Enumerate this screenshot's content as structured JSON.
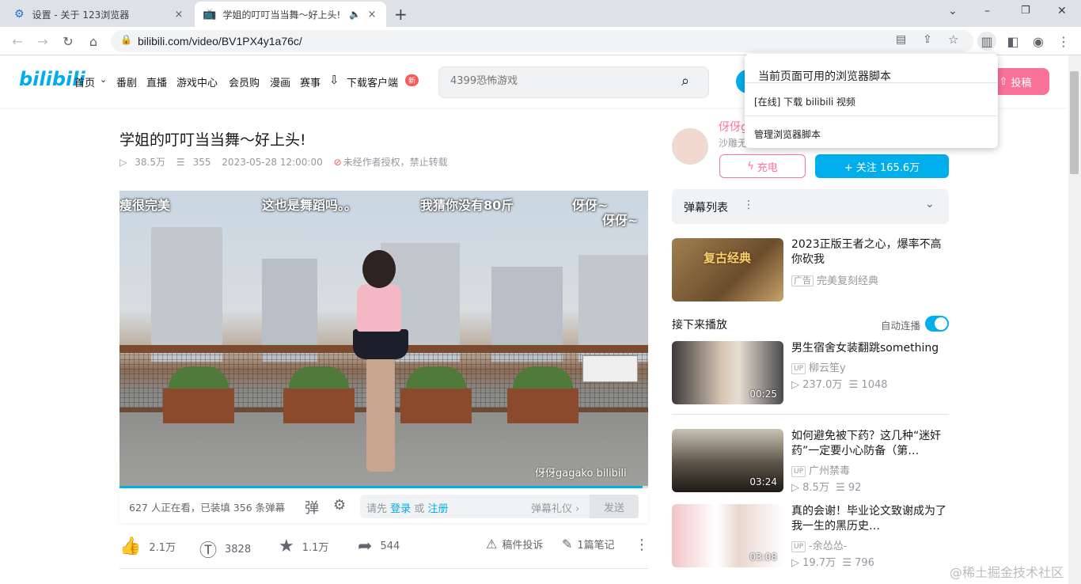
{
  "browser": {
    "tabs": [
      {
        "title": "设置 - 关于 123浏览器",
        "close": "×"
      },
      {
        "title": "学姐的叮叮当当舞～好上头!",
        "close": "×"
      }
    ],
    "new_tab": "+",
    "window_controls": {
      "dropdown": "⌄",
      "minimize": "–",
      "maximize": "❐",
      "close": "✕"
    },
    "url": "bilibili.com/video/BV1PX4y1a76c/"
  },
  "popup": {
    "heading": "当前页面可用的浏览器脚本",
    "items": [
      "[在线] 下载 bilibili 视频",
      "管理浏览器脚本"
    ]
  },
  "header": {
    "logo": "bilibili",
    "nav": [
      "首页",
      "番剧",
      "直播",
      "游戏中心",
      "会员购",
      "漫画",
      "赛事",
      "下载客户端"
    ],
    "new_badge": "新",
    "search_placeholder": "4399恐怖游戏",
    "upload_label": "投稿"
  },
  "video": {
    "title": "学姐的叮叮当当舞～好上头!",
    "views": "38.5万",
    "danmaku_count": "355",
    "date": "2023-05-28 12:00:00",
    "copyright": "未经作者授权，禁止转载",
    "subtitles": [
      "瘦很完美",
      "这也是舞蹈吗。。",
      "我猜你没有80斤",
      "伢伢~",
      "伢伢~"
    ],
    "watermark": "伢伢gagako bilibili",
    "progress": 0.99,
    "viewers_line": "627 人正在看，已装填 356 条弹幕",
    "danmaku_hint_prefix": "请先",
    "login": "登录",
    "or": "或",
    "register": "注册",
    "etiquette": "弹幕礼仪 ›",
    "send": "发送",
    "likes": "2.1万",
    "coins": "3828",
    "favorites": "1.1万",
    "shares": "544",
    "report": "稿件投诉",
    "notes": "1篇笔记"
  },
  "uploader": {
    "name": "伢伢gagako",
    "desc": "沙雕无",
    "charge": "充电",
    "follow": "+ 关注 165.6万"
  },
  "right": {
    "danmaku_list": "弹幕列表",
    "ad": {
      "title": "2023正版王者之心，爆率不高你砍我",
      "tag": "广告",
      "source": "完美复刻经典",
      "thumb_text": "复古经典"
    },
    "up_next": "接下来播放",
    "autoplay": "自动连播",
    "items": [
      {
        "title": "男生宿舍女装翻跳something",
        "up": "柳云笙y",
        "views": "237.0万",
        "danmaku": "1048",
        "duration": "00:25"
      },
      {
        "title": "如何避免被下药？这几种“迷奸药”一定要小心防备（第…",
        "up": "广州禁毒",
        "views": "8.5万",
        "danmaku": "92",
        "duration": "03:24"
      },
      {
        "title": "真的会谢！毕业论文致谢成为了我一生的黑历史…",
        "up": "-余怂怂-",
        "views": "19.7万",
        "danmaku": "796",
        "duration": "03:08"
      }
    ],
    "up_tag": "UP"
  },
  "site_watermark": "@稀土掘金技术社区",
  "colors": {
    "accent": "#00aeec",
    "pink": "#fb7299"
  }
}
